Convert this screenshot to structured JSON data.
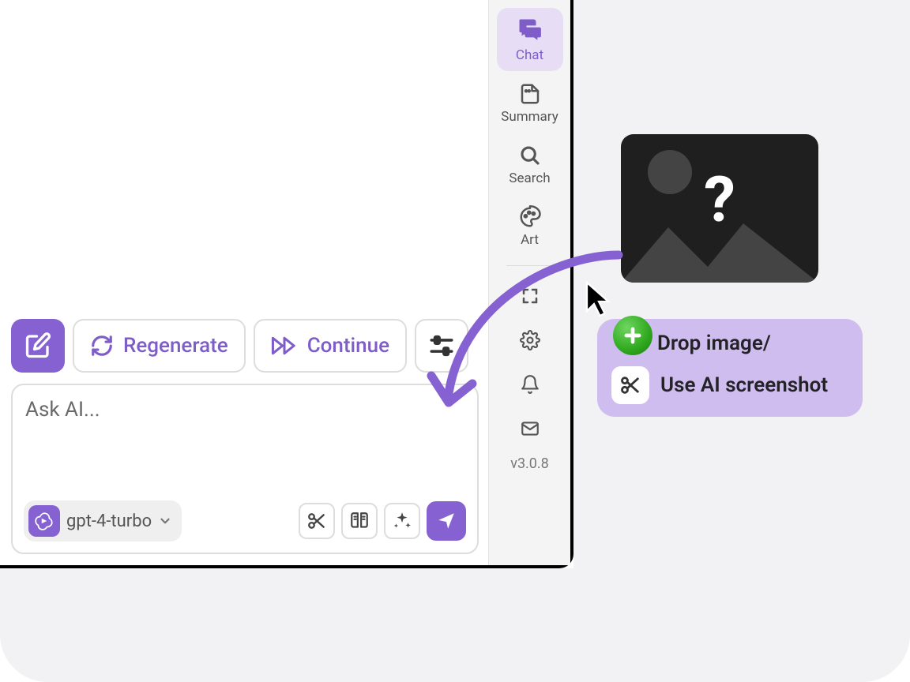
{
  "sidebar": {
    "chat": "Chat",
    "summary": "Summary",
    "search": "Search",
    "art": "Art",
    "version": "v3.0.8"
  },
  "actions": {
    "regenerate": "Regenerate",
    "continue": "Continue"
  },
  "input": {
    "placeholder": "Ask AI...",
    "model": "gpt-4-turbo"
  },
  "tooltip": {
    "drop": "Drop image/",
    "screenshot": "Use AI screenshot"
  }
}
